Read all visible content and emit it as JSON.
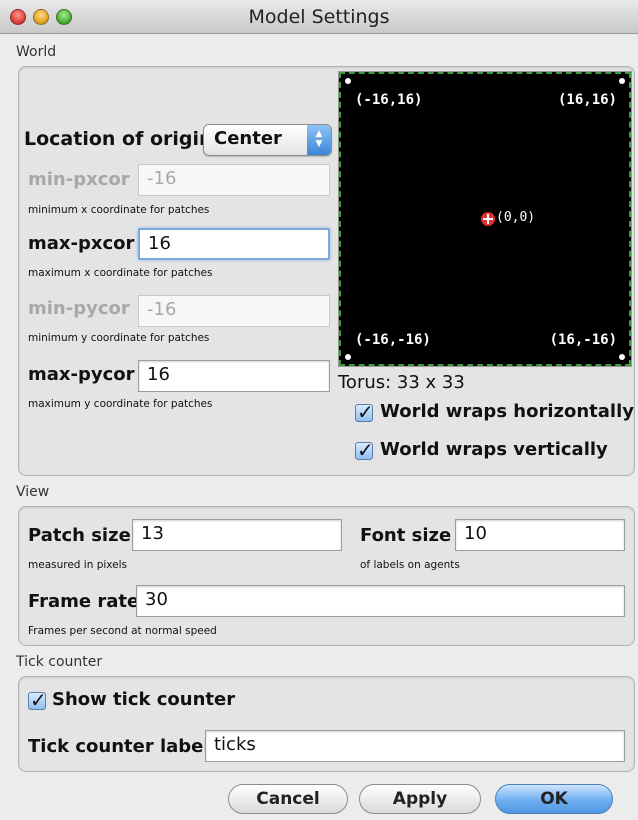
{
  "window": {
    "title": "Model Settings"
  },
  "world": {
    "section_label": "World",
    "origin_label": "Location of origin:",
    "origin_value": "Center",
    "min_pxcor": {
      "label": "min-pxcor",
      "value": "-16",
      "hint": "minimum x coordinate for patches"
    },
    "max_pxcor": {
      "label": "max-pxcor",
      "value": "16",
      "hint": "maximum x coordinate for patches"
    },
    "min_pycor": {
      "label": "min-pycor",
      "value": "-16",
      "hint": "minimum y coordinate for patches"
    },
    "max_pycor": {
      "label": "max-pycor",
      "value": "16",
      "hint": "maximum y coordinate for patches"
    },
    "preview": {
      "top_left": "(-16,16)",
      "top_right": "(16,16)",
      "center": "(0,0)",
      "bottom_left": "(-16,-16)",
      "bottom_right": "(16,-16)"
    },
    "torus": "Torus: 33 x 33",
    "wrap_horizontal": {
      "label": "World wraps horizontally",
      "checked": true
    },
    "wrap_vertical": {
      "label": "World wraps vertically",
      "checked": true
    }
  },
  "view": {
    "section_label": "View",
    "patch_size": {
      "label": "Patch size",
      "value": "13",
      "hint": "measured in pixels"
    },
    "font_size": {
      "label": "Font size",
      "value": "10",
      "hint": "of labels on agents"
    },
    "frame_rate": {
      "label": "Frame rate",
      "value": "30",
      "hint": "Frames per second at normal speed"
    }
  },
  "tick_counter": {
    "section_label": "Tick counter",
    "show": {
      "label": "Show tick counter",
      "checked": true
    },
    "label_field": {
      "label": "Tick counter label",
      "value": "ticks"
    }
  },
  "buttons": {
    "cancel": "Cancel",
    "apply": "Apply",
    "ok": "OK"
  },
  "colors": {
    "preview_bg": "#000000",
    "preview_border": "#3c9a3c",
    "origin_marker": "#e03030",
    "default_button": "#4f97e5"
  }
}
